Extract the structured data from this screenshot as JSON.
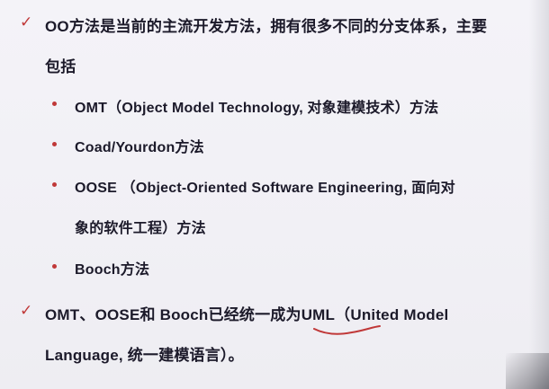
{
  "colors": {
    "accent": "#c03838",
    "text": "#1c1a2a",
    "background": "#f2f1f6"
  },
  "items": {
    "main1_line1": "OO方法是当前的主流开发方法，拥有很多不同的分支体系，主要",
    "main1_line2": "包括",
    "sub1": "OMT（Object Model Technology, 对象建模技术）方法",
    "sub2": "Coad/Yourdon方法",
    "sub3_line1": "OOSE （Object-Oriented Software Engineering, 面向对",
    "sub3_line2": "象的软件工程）方法",
    "sub4": "Booch方法",
    "main2_line1_pre": "OMT、OOSE和 Booch已经统一成为",
    "main2_line1_uml": "UML",
    "main2_line1_post": "（United Model",
    "main2_line2": "Language, 统一建模语言）。"
  },
  "markers": {
    "check": "✓"
  }
}
